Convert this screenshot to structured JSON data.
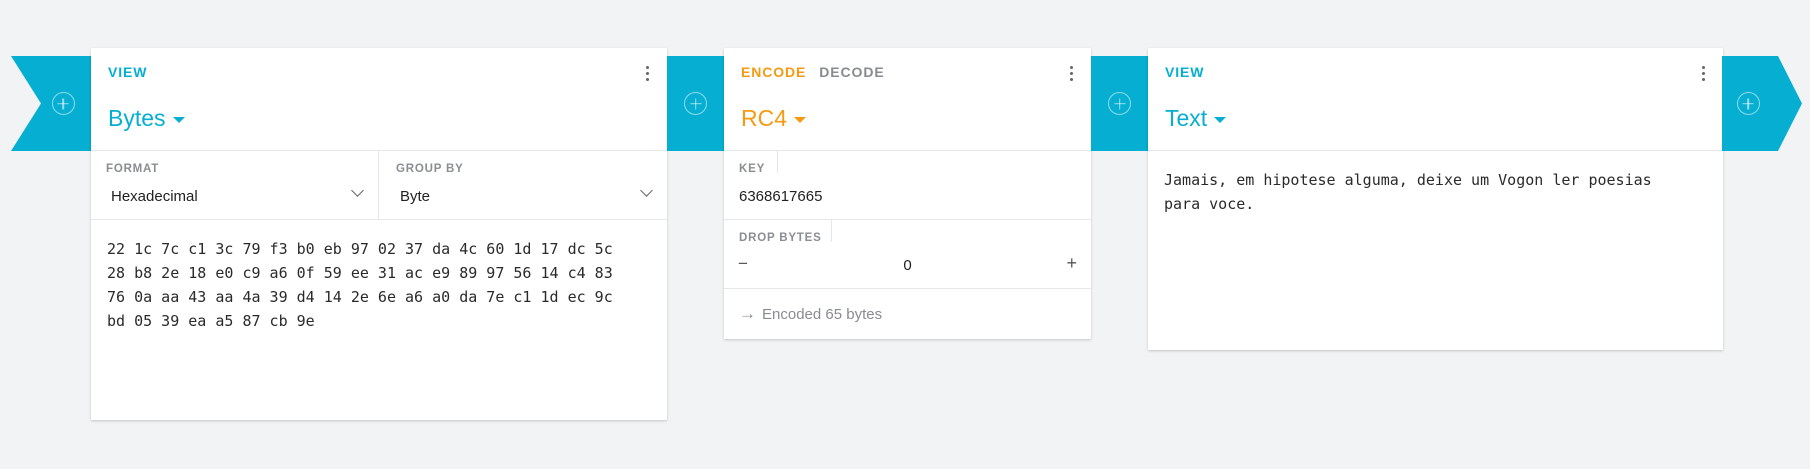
{
  "pipeline": {
    "card1": {
      "tab": "VIEW",
      "title": "Bytes",
      "format": {
        "label": "FORMAT",
        "value": "Hexadecimal"
      },
      "group_by": {
        "label": "GROUP BY",
        "value": "Byte"
      },
      "content_lines": [
        "22 1c 7c c1 3c 79 f3 b0 eb 97 02 37 da 4c 60 1d 17 dc 5c",
        "28 b8 2e 18 e0 c9 a6 0f 59 ee 31 ac e9 89 97 56 14 c4 83",
        "76 0a aa 43 aa 4a 39 d4 14 2e 6e a6 a0 da 7e c1 1d ec 9c",
        "bd 05 39 ea a5 87 cb 9e"
      ]
    },
    "card2": {
      "tab_active": "ENCODE",
      "tab_inactive": "DECODE",
      "title": "RC4",
      "key": {
        "label": "KEY",
        "value": "6368617665"
      },
      "drop_bytes": {
        "label": "DROP BYTES",
        "value": "0",
        "minus": "−",
        "plus": "+"
      },
      "status": {
        "arrow": "→",
        "text": "Encoded 65 bytes"
      }
    },
    "card3": {
      "tab": "VIEW",
      "title": "Text",
      "content_lines": [
        "Jamais, em hipotese alguma, deixe um Vogon ler poesias",
        "para voce."
      ]
    }
  },
  "colors": {
    "accent": "#06afd2",
    "encode": "#f69a14",
    "muted": "#888b90",
    "background": "#f2f3f5"
  },
  "icons": [
    "add-circle-icon",
    "kebab-menu-icon",
    "caret-down-icon",
    "chevron-down-icon",
    "minus-icon",
    "plus-icon",
    "arrow-right-icon"
  ]
}
